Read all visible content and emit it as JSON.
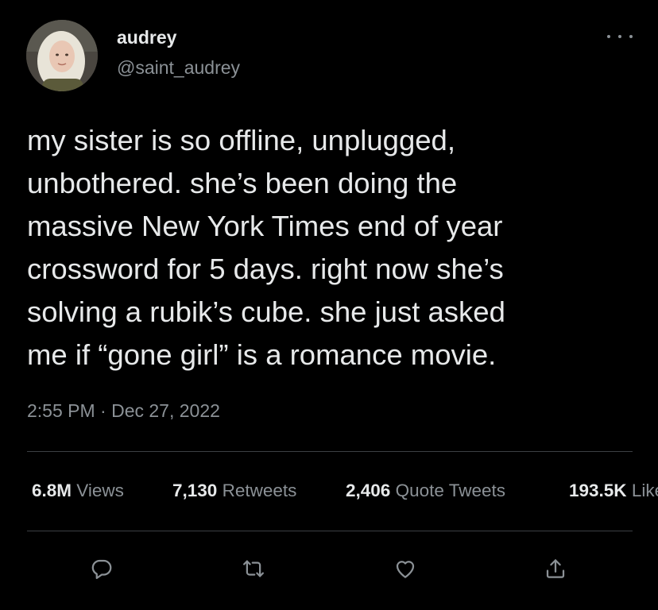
{
  "user": {
    "display_name": "audrey",
    "handle": "@saint_audrey",
    "avatar_icon": "profile-photo"
  },
  "tweet": {
    "lines": [
      "my sister is so offline, unplugged,",
      "unbothered. she’s been doing the",
      "massive New York Times end of year",
      "crossword for 5 days. right now she’s",
      "solving a rubik’s cube. she just asked",
      "me if “gone girl” is a romance movie."
    ],
    "timestamp": "2:55 PM · Dec 27, 2022"
  },
  "stats": [
    {
      "value": "6.8M",
      "label": "Views"
    },
    {
      "value": "7,130",
      "label": "Retweets"
    },
    {
      "value": "2,406",
      "label": "Quote Tweets"
    },
    {
      "value": "193.5K",
      "label": "Likes"
    }
  ],
  "actions": {
    "reply_icon": "reply-icon",
    "retweet_icon": "retweet-icon",
    "like_icon": "like-icon",
    "share_icon": "share-icon"
  },
  "colors": {
    "background": "#000000",
    "primary_text": "#e7e9ea",
    "secondary_text": "#8b9196",
    "divider": "#3c4044"
  }
}
